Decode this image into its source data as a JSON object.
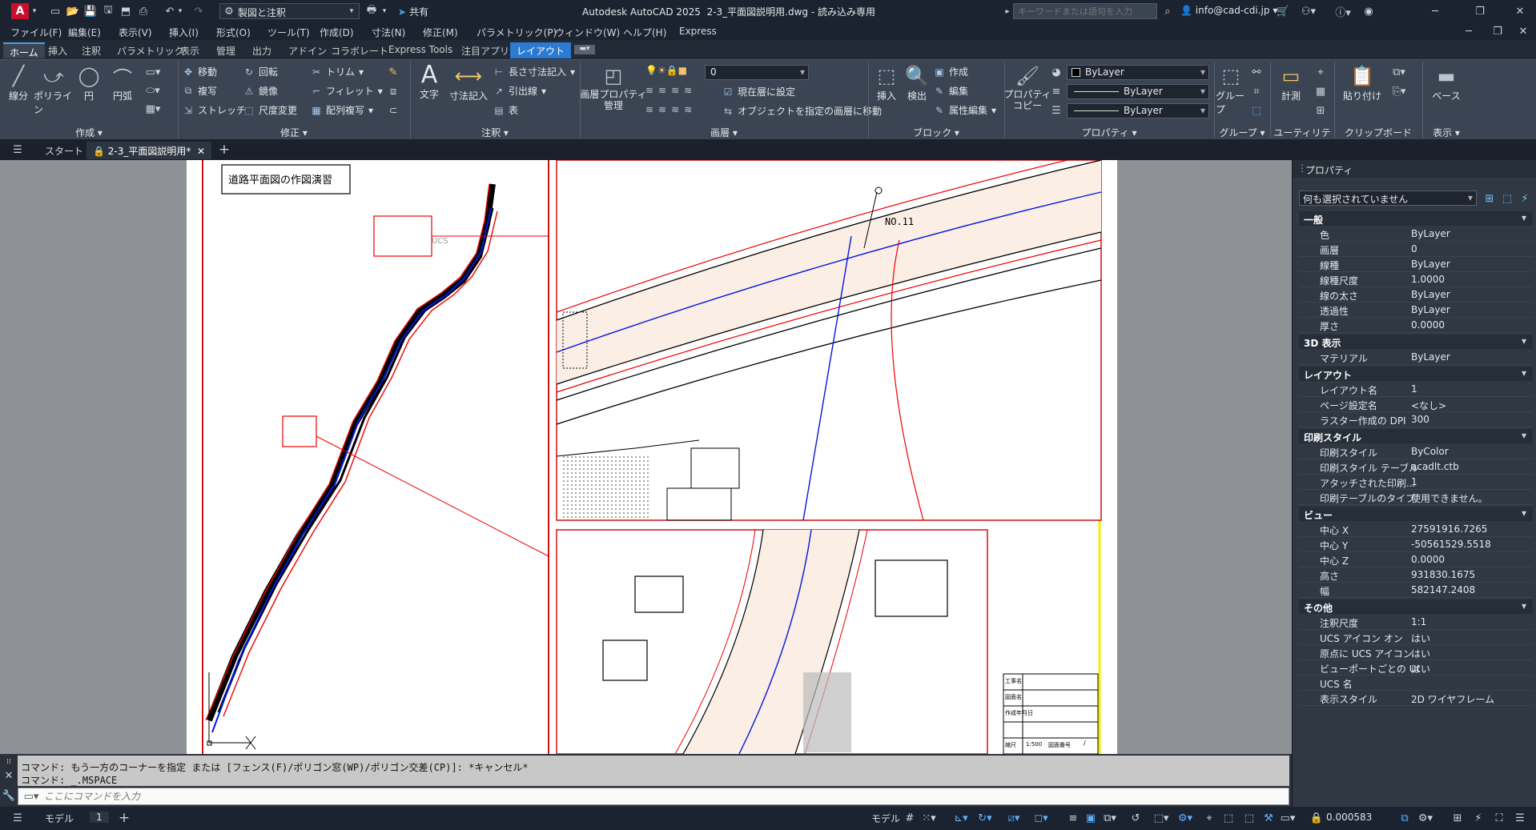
{
  "title_bar": {
    "app_title": "Autodesk AutoCAD 2025",
    "doc_title": "2-3_平面図説明用.dwg - 読み込み専用",
    "workspace": "製図と注釈",
    "share": "共有",
    "search_placeholder": "キーワードまたは語句を入力",
    "user": "info@cad-cdi.jp",
    "app_letter": "A"
  },
  "menu": [
    "ファイル(F)",
    "編集(E)",
    "表示(V)",
    "挿入(I)",
    "形式(O)",
    "ツール(T)",
    "作成(D)",
    "寸法(N)",
    "修正(M)",
    "パラメトリック(P)",
    "ウィンドウ(W)",
    "ヘルプ(H)",
    "Express"
  ],
  "ribbon_tabs": [
    "ホーム",
    "挿入",
    "注釈",
    "パラメトリック",
    "表示",
    "管理",
    "出力",
    "アドイン",
    "コラボレート",
    "Express Tools",
    "注目アプリ",
    "レイアウト"
  ],
  "ribbon": {
    "draw": {
      "title": "作成",
      "line": "線分",
      "polyline": "ポリライン",
      "circle": "円",
      "arc": "円弧"
    },
    "modify": {
      "title": "修正",
      "move": "移動",
      "rotate": "回転",
      "trim": "トリム",
      "copy": "複写",
      "mirror": "鏡像",
      "fillet": "フィレット",
      "stretch": "ストレッチ",
      "scale": "尺度変更",
      "array": "配列複写"
    },
    "annotation": {
      "title": "注釈",
      "text": "文字",
      "dimension": "寸法記入",
      "linear": "長さ寸法記入",
      "leader": "引出線",
      "table": "表"
    },
    "layers": {
      "title": "画層",
      "layer_props": "画層プロパティ\n管理",
      "layer_value": "0",
      "make_current": "現在層に設定",
      "match_layer": "オブジェクトを指定の画層に移動"
    },
    "block": {
      "title": "ブロック",
      "insert": "挿入",
      "detect": "検出",
      "create": "作成",
      "edit": "編集",
      "edit_attr": "属性編集"
    },
    "properties": {
      "title": "プロパティ",
      "match": "プロパティ\nコピー",
      "color": "ByLayer",
      "linetype": "ByLayer",
      "lineweight": "ByLayer"
    },
    "groups": {
      "title": "グループ",
      "group": "グループ"
    },
    "utilities": {
      "title": "ユーティリティ",
      "measure": "計測"
    },
    "clipboard": {
      "title": "クリップボード",
      "paste": "貼り付け"
    },
    "view": {
      "title": "表示",
      "base": "ベース"
    }
  },
  "doc_tabs": {
    "start": "スタート",
    "file": "2-3_平面図説明用*"
  },
  "drawing": {
    "title_box": "道路平面図の作図演習",
    "no11": "NO.11",
    "ucs": "UCS",
    "title_block": [
      "工事名",
      "図面名",
      "作成年月日",
      "縮尺",
      "1:500",
      "図面番号",
      "/"
    ]
  },
  "command": {
    "line1": "コマンド: もう一方のコーナーを指定 または [フェンス(F)/ポリゴン窓(WP)/ポリゴン交差(CP)]: *キャンセル*",
    "line2": "コマンド: _.MSPACE",
    "placeholder": "ここにコマンドを入力"
  },
  "properties": {
    "title": "プロパティ",
    "selection": "何も選択されていません",
    "sections": [
      {
        "name": "一般",
        "rows": [
          [
            "色",
            "ByLayer"
          ],
          [
            "画層",
            "0"
          ],
          [
            "線種",
            "ByLayer"
          ],
          [
            "線種尺度",
            "1.0000"
          ],
          [
            "線の太さ",
            "ByLayer"
          ],
          [
            "透過性",
            "ByLayer"
          ],
          [
            "厚さ",
            "0.0000"
          ]
        ]
      },
      {
        "name": "3D 表示",
        "rows": [
          [
            "マテリアル",
            "ByLayer"
          ]
        ]
      },
      {
        "name": "レイアウト",
        "rows": [
          [
            "レイアウト名",
            "1"
          ],
          [
            "ページ設定名",
            "<なし>"
          ],
          [
            "ラスター作成の DPI",
            "300"
          ]
        ]
      },
      {
        "name": "印刷スタイル",
        "rows": [
          [
            "印刷スタイル",
            "ByColor"
          ],
          [
            "印刷スタイル テーブル",
            "acadlt.ctb"
          ],
          [
            "アタッチされた印刷...",
            "1"
          ],
          [
            "印刷テーブルのタイプ",
            "使用できません。"
          ]
        ]
      },
      {
        "name": "ビュー",
        "rows": [
          [
            "中心 X",
            "27591916.7265"
          ],
          [
            "中心 Y",
            "-50561529.5518"
          ],
          [
            "中心 Z",
            "0.0000"
          ],
          [
            "高さ",
            "931830.1675"
          ],
          [
            "幅",
            "582147.2408"
          ]
        ]
      },
      {
        "name": "その他",
        "rows": [
          [
            "注釈尺度",
            "1:1"
          ],
          [
            "UCS アイコン オン",
            "はい"
          ],
          [
            "原点に UCS アイコン",
            "はい"
          ],
          [
            "ビューポートごとの UCS",
            "はい"
          ],
          [
            "UCS 名",
            ""
          ],
          [
            "表示スタイル",
            "2D ワイヤフレーム"
          ]
        ]
      }
    ]
  },
  "status": {
    "model": "モデル",
    "layout1": "1",
    "paper": "モデル",
    "scale": "0.000583"
  }
}
